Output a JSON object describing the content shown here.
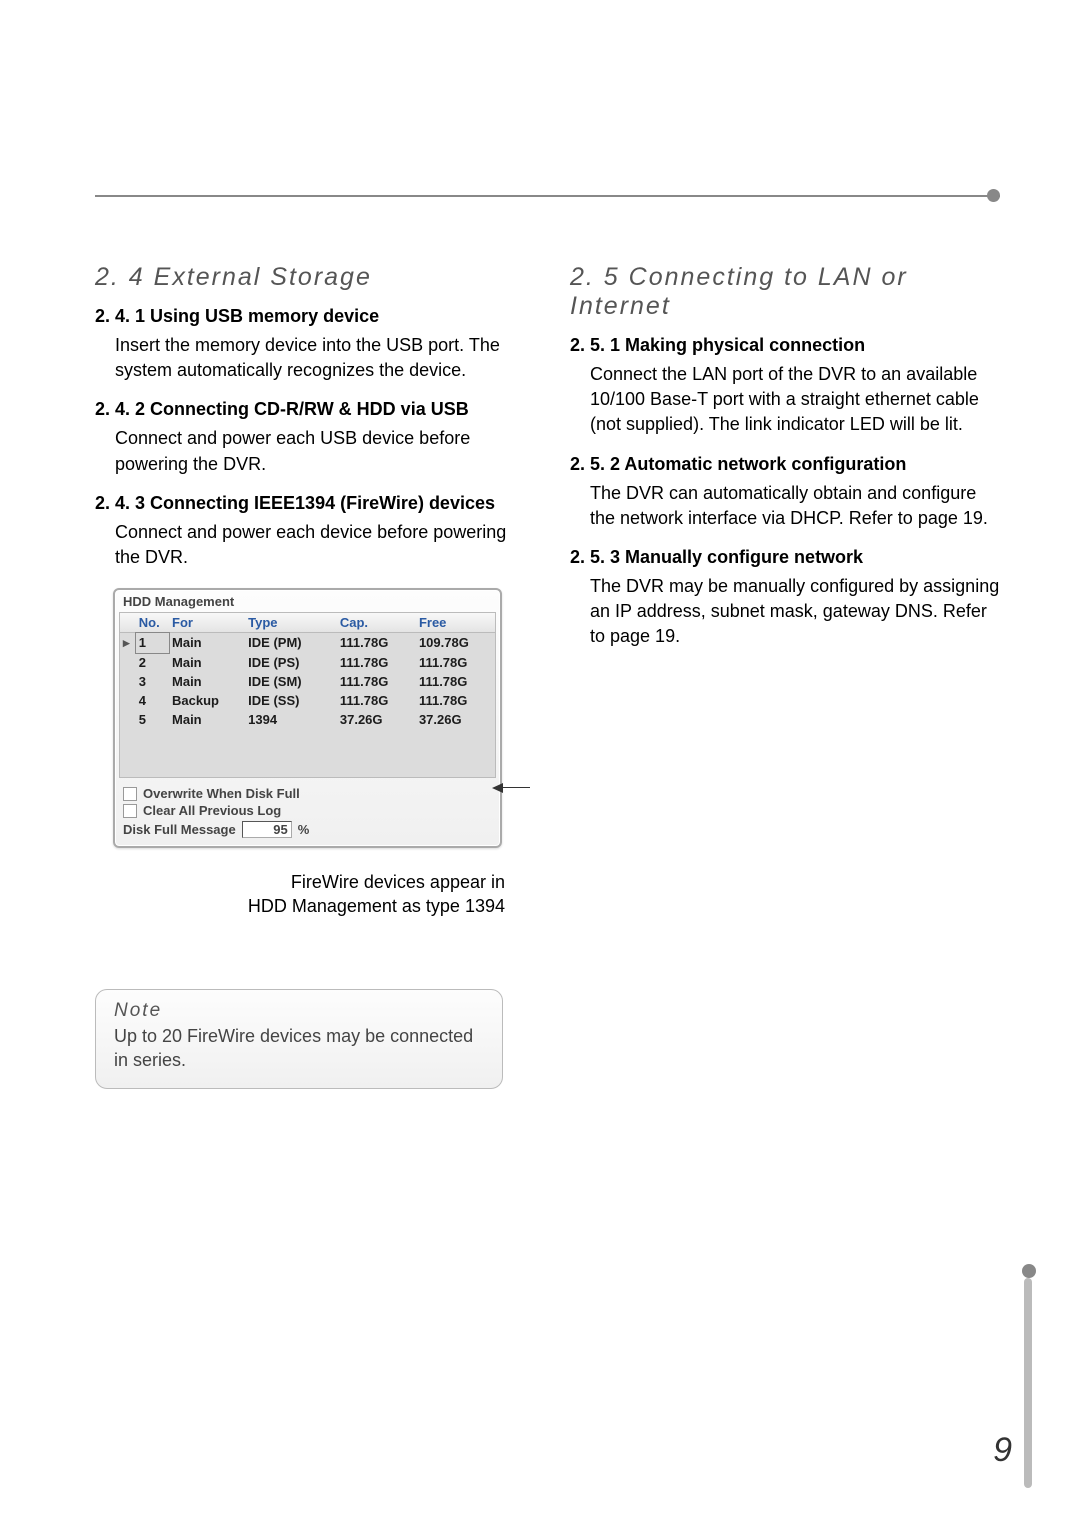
{
  "page_number": "9",
  "left": {
    "h2": "2. 4 External Storage",
    "s1": {
      "h3": "2. 4. 1 Using USB memory device",
      "p": "Insert the memory device into the USB port. The system automatically recognizes the device."
    },
    "s2": {
      "h3": "2. 4. 2 Connecting CD-R/RW & HDD via USB",
      "p": "Connect and power each USB device before powering the DVR."
    },
    "s3": {
      "h3": "2. 4. 3 Connecting IEEE1394 (FireWire) devices",
      "p": "Connect and power each device before powering the DVR."
    },
    "caption_l1": "FireWire devices appear in",
    "caption_l2": "HDD Management as type 1394",
    "note_title": "Note",
    "note_body": "Up to 20 FireWire devices may be connected in series."
  },
  "right": {
    "h2": "2. 5 Connecting to LAN or Internet",
    "s1": {
      "h3": "2. 5. 1 Making physical connection",
      "p": "Connect the LAN port of the DVR to an available 10/100 Base-T port with a straight ethernet cable (not supplied). The link indicator LED will be lit."
    },
    "s2": {
      "h3": "2. 5. 2 Automatic network configuration",
      "p": "The DVR can automatically obtain and configure the network interface via DHCP. Refer to page 19."
    },
    "s3": {
      "h3": "2. 5. 3 Manually configure network",
      "p": "The DVR may be manually configured by assigning an IP address, subnet mask, gateway DNS. Refer to page 19."
    }
  },
  "hdd": {
    "title": "HDD Management",
    "hdr": {
      "sel": "",
      "no": "No.",
      "for": "For",
      "type": "Type",
      "cap": "Cap.",
      "free": "Free"
    },
    "rows": [
      {
        "sel": "▸",
        "no": "1",
        "for": "Main",
        "type": "IDE (PM)",
        "cap": "111.78G",
        "free": "109.78G"
      },
      {
        "sel": "",
        "no": "2",
        "for": "Main",
        "type": "IDE (PS)",
        "cap": "111.78G",
        "free": "111.78G"
      },
      {
        "sel": "",
        "no": "3",
        "for": "Main",
        "type": "IDE (SM)",
        "cap": "111.78G",
        "free": "111.78G"
      },
      {
        "sel": "",
        "no": "4",
        "for": "Backup",
        "type": "IDE (SS)",
        "cap": "111.78G",
        "free": "111.78G"
      },
      {
        "sel": "",
        "no": "5",
        "for": "Main",
        "type": "1394",
        "cap": "37.26G",
        "free": "37.26G"
      }
    ],
    "opt1": "Overwrite When Disk Full",
    "opt2": "Clear All Previous Log",
    "msg_label": "Disk Full Message",
    "msg_value": "95",
    "msg_unit": "%"
  }
}
